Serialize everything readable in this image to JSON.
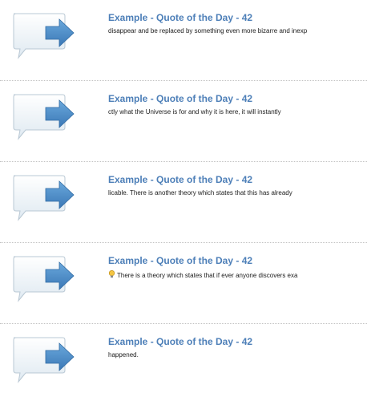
{
  "feed": {
    "items": [
      {
        "title": "Example - Quote of the Day - 42",
        "snippet": "disappear and be replaced by something even more bizarre and inexp",
        "icon": "speech-arrow-icon"
      },
      {
        "title": "Example - Quote of the Day - 42",
        "snippet": "ctly what the Universe is for and why it is here, it will instantly",
        "icon": "speech-arrow-icon"
      },
      {
        "title": "Example - Quote of the Day - 42",
        "snippet": "licable. There is another theory which states that this has already",
        "icon": "speech-arrow-icon"
      },
      {
        "title": "Example - Quote of the Day - 42",
        "snippet": "There is a theory which states that if ever anyone discovers exa",
        "icon": "speech-arrow-icon",
        "prefix_icon": "lightbulb-icon"
      },
      {
        "title": "Example - Quote of the Day - 42",
        "snippet": "happened.",
        "icon": "speech-arrow-icon"
      }
    ]
  },
  "colors": {
    "title": "#4d7fb8",
    "arrow": "#4f8fcb",
    "divider": "#c2c2c2"
  }
}
